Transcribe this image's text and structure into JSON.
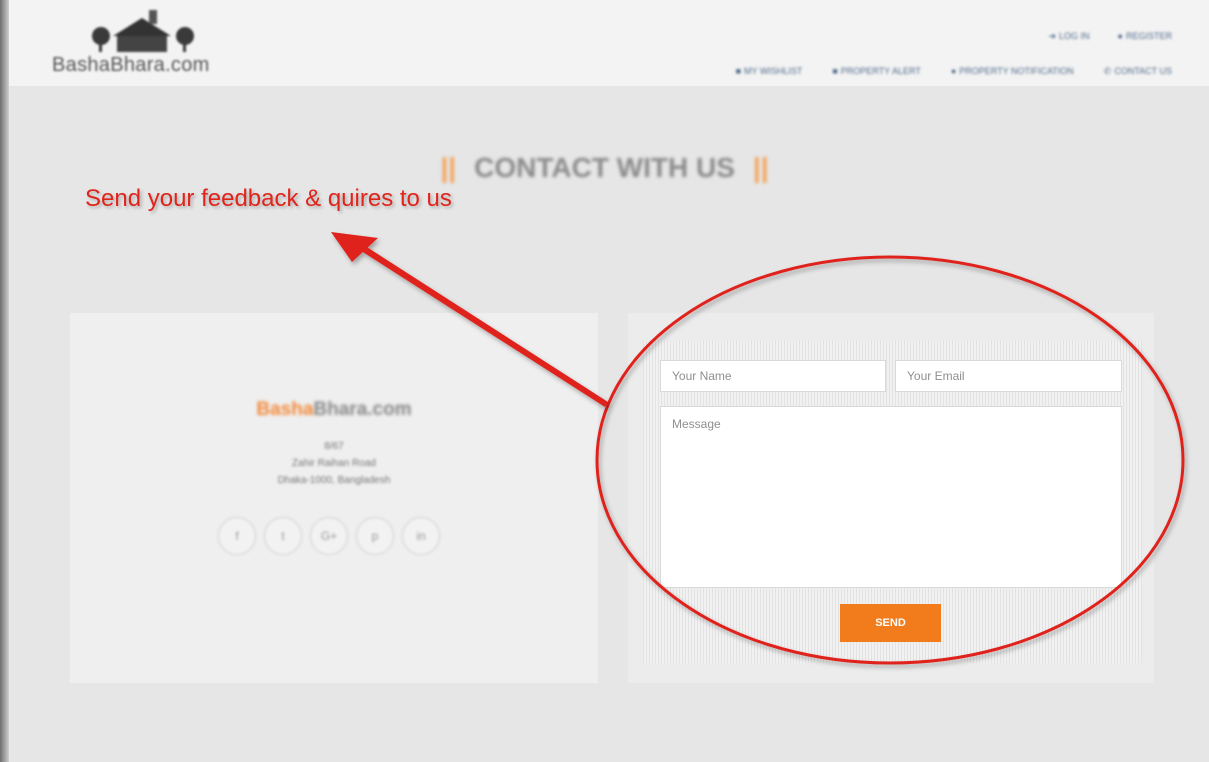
{
  "header": {
    "logo_text": "BashaBhara.com",
    "top_links": [
      "LOG IN",
      "REGISTER"
    ],
    "nav_items": [
      "MY WISHLIST",
      "PROPERTY ALERT",
      "PROPERTY NOTIFICATION",
      "CONTACT US"
    ]
  },
  "section": {
    "heading": "CONTACT WITH US",
    "heading_bars": "||"
  },
  "annotation": {
    "text": "Send your feedback & quires to us",
    "color": "#e0241b"
  },
  "company": {
    "brand_accent": "Basha",
    "brand_rest": "Bhara.com",
    "address_lines": [
      "8/67",
      "Zahir Raihan Road",
      "Dhaka-1000, Bangladesh"
    ],
    "socials": [
      {
        "icon": "facebook-icon",
        "glyph": "f"
      },
      {
        "icon": "twitter-icon",
        "glyph": "t"
      },
      {
        "icon": "google-plus-icon",
        "glyph": "G+"
      },
      {
        "icon": "pinterest-icon",
        "glyph": "p"
      },
      {
        "icon": "linkedin-icon",
        "glyph": "in"
      }
    ]
  },
  "form": {
    "name_placeholder": "Your Name",
    "email_placeholder": "Your Email",
    "message_placeholder": "Message",
    "send_label": "SEND"
  },
  "colors": {
    "accent": "#f27c1c",
    "annotation": "#e0241b",
    "background": "#e6e6e6"
  }
}
